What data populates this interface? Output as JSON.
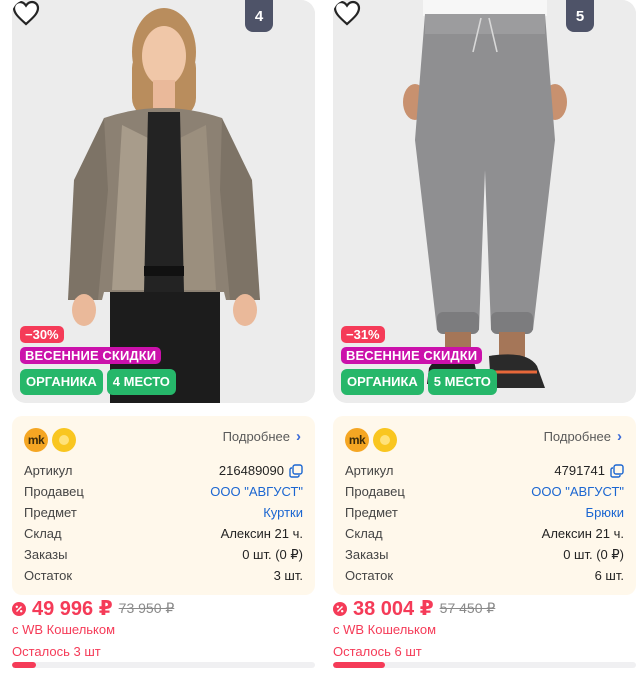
{
  "colors": {
    "accent": "#f53b58",
    "promo": "#cb11ab",
    "green": "#26b76a",
    "link": "#1b66d1",
    "badge": "#4e5368",
    "info_bg": "#fff8eb"
  },
  "products": [
    {
      "rank": "4",
      "discount": "−30%",
      "promo": "ВЕСЕННИЕ СКИДКИ",
      "tag_organic": "ОРГАНИКА",
      "tag_place": "4 МЕСТО",
      "more_label": "Подробнее",
      "rows": [
        {
          "key": "Артикул",
          "value": "216489090"
        },
        {
          "key": "Продавец",
          "value": "ООО \"АВГУСТ\""
        },
        {
          "key": "Предмет",
          "value": "Куртки"
        },
        {
          "key": "Склад",
          "value": "Алексин 21 ч."
        },
        {
          "key": "Заказы",
          "value": "0 шт. (0 ₽)"
        },
        {
          "key": "Остаток",
          "value": "3 шт."
        }
      ],
      "price": "49 996 ₽",
      "old_price": "73 950 ₽",
      "wallet_note": "с WB Кошельком",
      "stock_left": "Осталось 3 шт",
      "stock_fill_fraction": 0.08
    },
    {
      "rank": "5",
      "discount": "−31%",
      "promo": "ВЕСЕННИЕ СКИДКИ",
      "tag_organic": "ОРГАНИКА",
      "tag_place": "5 МЕСТО",
      "more_label": "Подробнее",
      "rows": [
        {
          "key": "Артикул",
          "value": "4791741"
        },
        {
          "key": "Продавец",
          "value": "ООО \"АВГУСТ\""
        },
        {
          "key": "Предмет",
          "value": "Брюки"
        },
        {
          "key": "Склад",
          "value": "Алексин 21 ч."
        },
        {
          "key": "Заказы",
          "value": "0 шт. (0 ₽)"
        },
        {
          "key": "Остаток",
          "value": "6 шт."
        }
      ],
      "price": "38 004 ₽",
      "old_price": "57 450 ₽",
      "wallet_note": "с WB Кошельком",
      "stock_left": "Осталось 6 шт",
      "stock_fill_fraction": 0.17
    }
  ]
}
